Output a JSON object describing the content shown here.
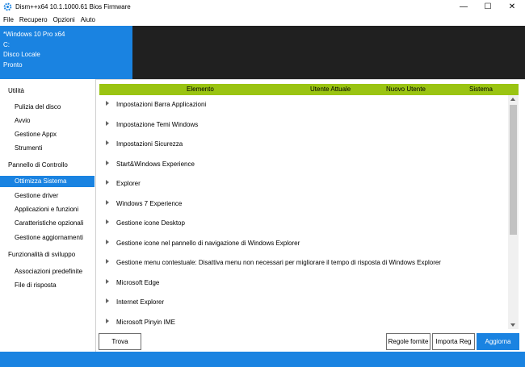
{
  "window": {
    "title": "Dism++x64 10.1.1000.61 Bios Firmware",
    "app_icon": "gear-blue-icon",
    "controls": {
      "minimize": "—",
      "maximize": "☐",
      "close": "✕"
    }
  },
  "menubar": {
    "items": [
      "File",
      "Recupero",
      "Opzioni",
      "Aiuto"
    ]
  },
  "session": {
    "lines": [
      "*Windows 10 Pro x64",
      "C:",
      "Disco Locale",
      "Pronto"
    ]
  },
  "sidebar": {
    "items": [
      {
        "label": "Utilità",
        "kind": "category"
      },
      {
        "label": "Pulizia del disco",
        "kind": "item"
      },
      {
        "label": "Avvio",
        "kind": "item"
      },
      {
        "label": "Gestione Appx",
        "kind": "item"
      },
      {
        "label": "Strumenti",
        "kind": "item"
      },
      {
        "label": "Pannello di Controllo",
        "kind": "category"
      },
      {
        "label": "Ottimizza Sistema",
        "kind": "item",
        "active": true
      },
      {
        "label": "Gestione driver",
        "kind": "item"
      },
      {
        "label": "Applicazioni e funzioni",
        "kind": "item"
      },
      {
        "label": "Caratteristiche opzionali",
        "kind": "item"
      },
      {
        "label": "Gestione aggiornamenti",
        "kind": "item"
      },
      {
        "label": "Funzionalità di sviluppo",
        "kind": "category"
      },
      {
        "label": "Associazioni predefinite",
        "kind": "item"
      },
      {
        "label": "File di risposta",
        "kind": "item"
      }
    ]
  },
  "table": {
    "columns": [
      "Elemento",
      "Utente Attuale",
      "Nuovo Utente",
      "Sistema"
    ],
    "rows": [
      "Impostazioni Barra Applicazioni",
      "Impostazione Temi Windows",
      "Impostazioni Sicurezza",
      "Start&Windows Experience",
      "Explorer",
      "Windows 7 Experience",
      "Gestione icone Desktop",
      "Gestione icone nel pannello di navigazione di Windows Explorer",
      "Gestione menu contestuale: Disattiva menu non necessari per migliorare il tempo di risposta di Windows Explorer",
      "Microsoft Edge",
      "Internet Explorer",
      "Microsoft Pinyin IME"
    ]
  },
  "buttons": {
    "find": "Trova",
    "rules": "Regole fornite",
    "import_reg": "Importa Reg",
    "update": "Aggiorna"
  },
  "colors": {
    "accent": "#1a83e1",
    "header_green": "#9ac412",
    "dark_panel": "#202020"
  }
}
